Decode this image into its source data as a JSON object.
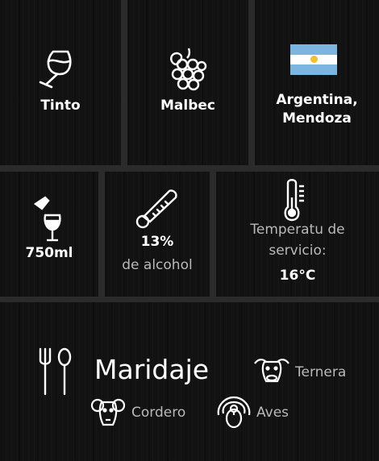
{
  "wine_info": {
    "type": "Tinto",
    "grape": "Malbec",
    "origin": "Argentina,\nMendoza",
    "origin_line1": "Argentina,",
    "origin_line2": "Mendoza",
    "volume": "750ml",
    "alcohol_value": "13%",
    "alcohol_label": "de alcohol",
    "temperature_label_1": "Temperatu de",
    "temperature_label_2": "servicio:",
    "temperature_value": "16°C"
  },
  "pairing": {
    "title": "Maridaje",
    "items": [
      {
        "label": "Ternera",
        "icon": "cow-head-icon"
      },
      {
        "label": "Cordero",
        "icon": "ram-head-icon"
      },
      {
        "label": "Aves",
        "icon": "turkey-icon"
      }
    ]
  },
  "icons": {
    "type": "wine-glass-icon",
    "grape": "grapes-icon",
    "origin": "argentina-flag-icon",
    "volume": "bottle-glass-icon",
    "alcohol": "thermometer-icon",
    "temperature": "thermometer-icon",
    "pairing": "fork-spoon-icon"
  },
  "colors": {
    "tile_background": "#121212",
    "gutter": "#2b2b2b",
    "flag_blue": "#7ab6e0",
    "flag_sun": "#f2c12e",
    "muted_text": "#b9b9b9"
  }
}
